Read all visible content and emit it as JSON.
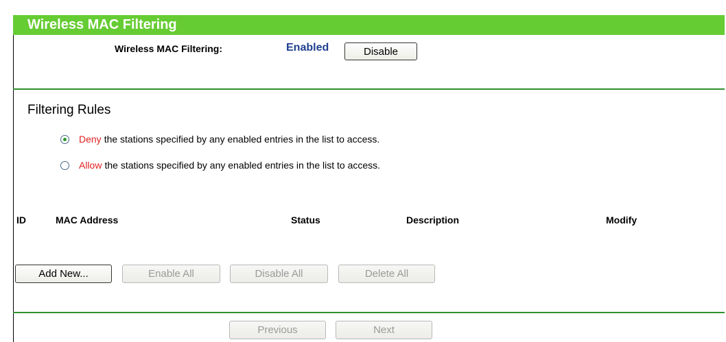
{
  "header": {
    "title": "Wireless MAC Filtering"
  },
  "status": {
    "label": "Wireless MAC Filtering:",
    "value": "Enabled",
    "toggle_button": "Disable"
  },
  "filtering_rules": {
    "title": "Filtering Rules",
    "options": [
      {
        "keyword": "Deny",
        "text": "the stations specified by any enabled entries in the list to access.",
        "selected": true
      },
      {
        "keyword": "Allow",
        "text": "the stations specified by any enabled entries in the list to access.",
        "selected": false
      }
    ]
  },
  "table": {
    "columns": [
      "ID",
      "MAC Address",
      "Status",
      "Description",
      "Modify"
    ],
    "rows": []
  },
  "actions": {
    "add_new": "Add New...",
    "enable_all": "Enable All",
    "disable_all": "Disable All",
    "delete_all": "Delete All"
  },
  "pagination": {
    "previous": "Previous",
    "next": "Next"
  },
  "colors": {
    "header_bar": "#66cc33",
    "divider": "#2f8f2f",
    "status_value": "#1f3f8f",
    "keyword": "#e02020"
  }
}
